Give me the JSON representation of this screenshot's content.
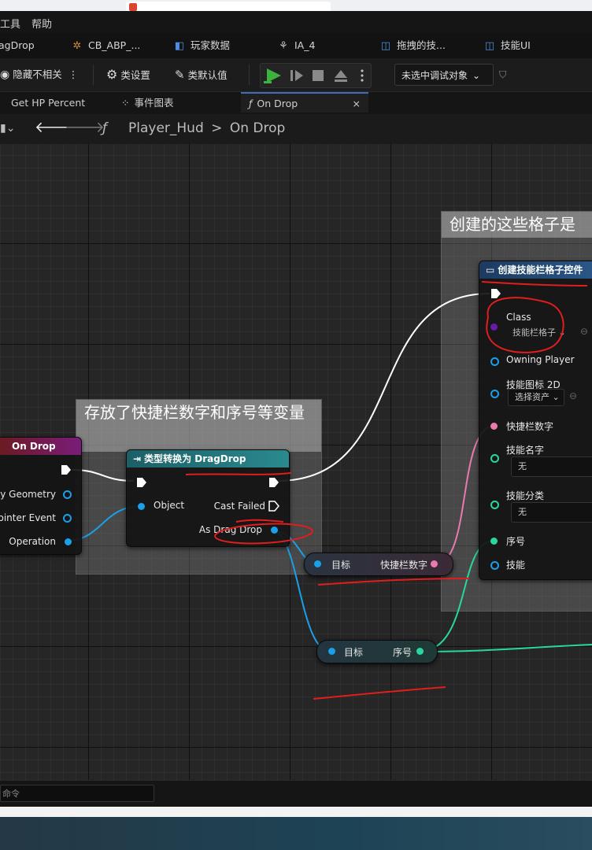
{
  "menu": {
    "items": [
      "工具",
      "帮助"
    ]
  },
  "asset_tabs": [
    {
      "label": "agDrop",
      "icon": ""
    },
    {
      "label": "CB_ABP_...",
      "icon": "cb-icon"
    },
    {
      "label": "玩家数据",
      "icon": "struct-icon"
    },
    {
      "label": "IA_4",
      "icon": "input-action-icon"
    },
    {
      "label": "拖拽的技...",
      "icon": "widget-icon"
    },
    {
      "label": "技能UI",
      "icon": "widget-icon"
    }
  ],
  "toolbar": {
    "hide_unrelated": "隐藏不相关",
    "class_settings": "类设置",
    "class_defaults": "类默认值",
    "debug_target": "未选中调试对象"
  },
  "doc_tabs": [
    {
      "label": "Get HP Percent"
    },
    {
      "label": "事件图表"
    },
    {
      "label": "On Drop",
      "close": "×"
    }
  ],
  "breadcrumb": {
    "root": "Player_Hud",
    "separator": ">",
    "leaf": "On Drop"
  },
  "comments": {
    "left": "存放了快捷栏数字和序号等变量",
    "right": "创建的这些格子是"
  },
  "nodes": {
    "on_drop": {
      "title": "On Drop",
      "pins": [
        "My Geometry",
        "Pointer Event",
        "Operation"
      ]
    },
    "cast": {
      "title": "类型转换为 DragDrop",
      "pins": {
        "object": "Object",
        "cast_failed": "Cast Failed",
        "as": "As Drag Drop"
      }
    },
    "create_widget": {
      "title": "创建技能栏格子控件",
      "pins": {
        "class": "Class",
        "class_value": "技能栏格子",
        "owning_player": "Owning Player",
        "skill_icon": "技能图标 2D",
        "skill_icon_value": "选择资产",
        "shortcut_number": "快捷栏数字",
        "skill_name": "技能名字",
        "skill_name_value": "无",
        "skill_category": "技能分类",
        "skill_category_value": "无",
        "index": "序号",
        "skill": "技能"
      }
    },
    "get_shortcut": {
      "target": "目标",
      "output": "快捷栏数字"
    },
    "get_index": {
      "target": "目标",
      "output": "序号"
    }
  },
  "console": {
    "placeholder": "命令"
  },
  "colors": {
    "exec": "#ffffff",
    "object_pin": "#1aa0e8",
    "int_pin": "#e87ab0",
    "struct_pin": "#2ad6a0",
    "class_pin": "#6a1aa8",
    "event_header": "#7a1c1c",
    "cast_header": "#1e6a6e",
    "create_header": "#1f3f66",
    "annotation": "#e01e1e"
  }
}
